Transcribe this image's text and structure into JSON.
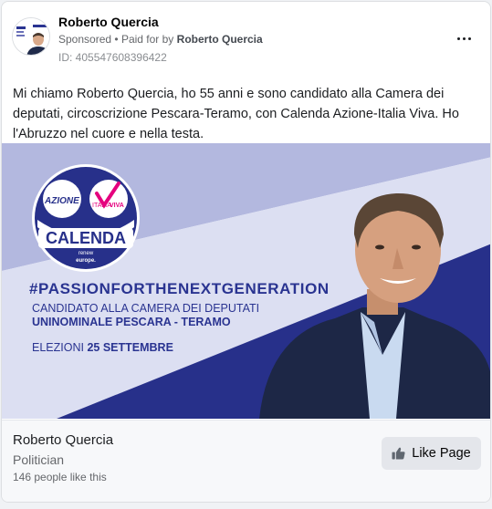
{
  "post": {
    "page_name": "Roberto Quercia",
    "sponsored_label": "Sponsored",
    "separator": "•",
    "paid_for_prefix": "Paid for by",
    "paid_for_name": "Roberto Quercia",
    "ad_id": "ID: 405547608396422",
    "more_icon": "more-horizontal-icon",
    "body_text": "Mi chiamo Roberto Quercia, ho 55 anni e sono candidato alla Camera dei deputati, circoscrizione Pescara-Teramo, con Calenda Azione-Italia Viva. Ho l'Abruzzo nel cuore e nella testa."
  },
  "creative": {
    "logo": {
      "azione": "AZIONE",
      "italia": "ITALIA",
      "viva": "VIVA",
      "calenda": "CALENDA",
      "renew_line1": "renew",
      "renew_line2": "europe."
    },
    "hashtag": "#PASSIONFORTHENEXTGENERATION",
    "candidate_line1": "CANDIDATO ALLA CAMERA DEI DEPUTATI",
    "candidate_line2": "UNINOMINALE PESCARA - TERAMO",
    "election_prefix": "ELEZIONI",
    "election_date": "25 SETTEMBRE"
  },
  "footer": {
    "page_name": "Roberto Quercia",
    "category": "Politician",
    "likes": "146 people like this",
    "like_button": "Like Page",
    "like_icon": "thumbs-up-icon"
  },
  "colors": {
    "brand_navy": "#2a3491",
    "banner_light": "#aeb3dc",
    "banner_dark": "#27308a",
    "like_button_bg": "#e4e6eb"
  }
}
